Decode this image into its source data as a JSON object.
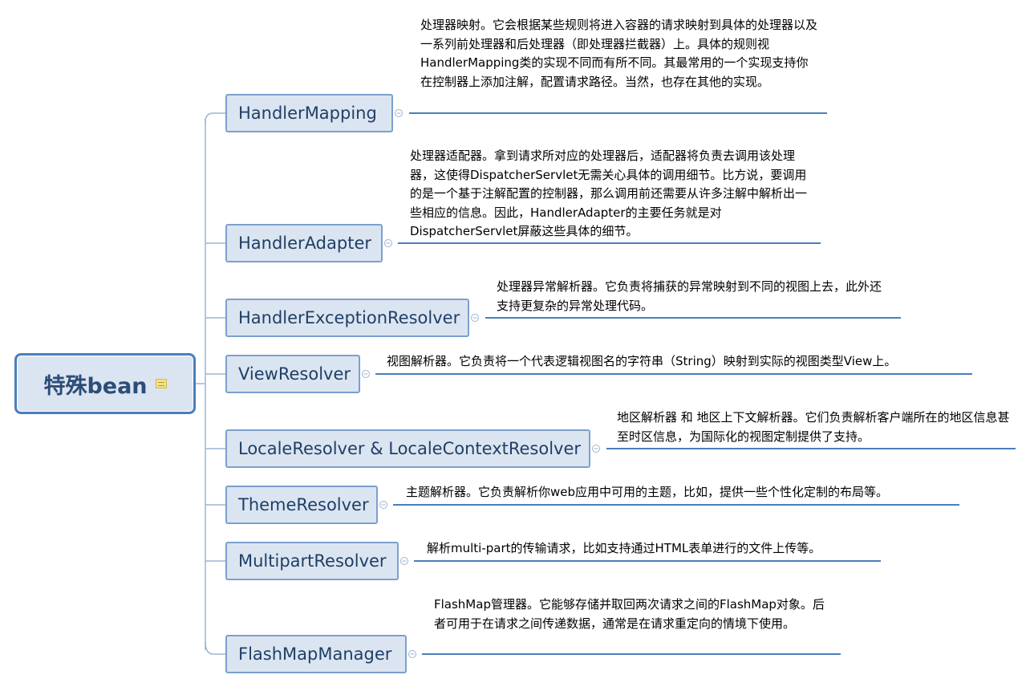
{
  "root": {
    "label": "特殊bean",
    "note_icon": "note-icon"
  },
  "branches": [
    {
      "label": "HandlerMapping",
      "description": "处理器映射。它会根据某些规则将进入容器的请求映射到具体的处理器以及一系列前处理器和后处理器（即处理器拦截器）上。具体的规则视HandlerMapping类的实现不同而有所不同。其最常用的一个实现支持你在控制器上添加注解，配置请求路径。当然，也存在其他的实现。"
    },
    {
      "label": "HandlerAdapter",
      "description": "处理器适配器。拿到请求所对应的处理器后，适配器将负责去调用该处理器，这使得DispatcherServlet无需关心具体的调用细节。比方说，要调用的是一个基于注解配置的控制器，那么调用前还需要从许多注解中解析出一些相应的信息。因此，HandlerAdapter的主要任务就是对DispatcherServlet屏蔽这些具体的细节。"
    },
    {
      "label": "HandlerExceptionResolver",
      "description": "处理器异常解析器。它负责将捕获的异常映射到不同的视图上去，此外还支持更复杂的异常处理代码。"
    },
    {
      "label": "ViewResolver",
      "description": "视图解析器。它负责将一个代表逻辑视图名的字符串（String）映射到实际的视图类型View上。"
    },
    {
      "label": "LocaleResolver & LocaleContextResolver",
      "description": "地区解析器 和 地区上下文解析器。它们负责解析客户端所在的地区信息甚至时区信息，为国际化的视图定制提供了支持。"
    },
    {
      "label": "ThemeResolver",
      "description": "主题解析器。它负责解析你web应用中可用的主题，比如，提供一些个性化定制的布局等。"
    },
    {
      "label": "MultipartResolver",
      "description": "解析multi-part的传输请求，比如支持通过HTML表单进行的文件上传等。"
    },
    {
      "label": "FlashMapManager",
      "description": "FlashMap管理器。它能够存储并取回两次请求之间的FlashMap对象。后者可用于在请求之间传递数据，通常是在请求重定向的情境下使用。"
    }
  ],
  "colors": {
    "node_fill": "#dbe5f1",
    "node_border": "#7ba0cd",
    "root_border": "#4a7ebb",
    "connector": "#4a7ebb",
    "text": "#1f3f66"
  }
}
